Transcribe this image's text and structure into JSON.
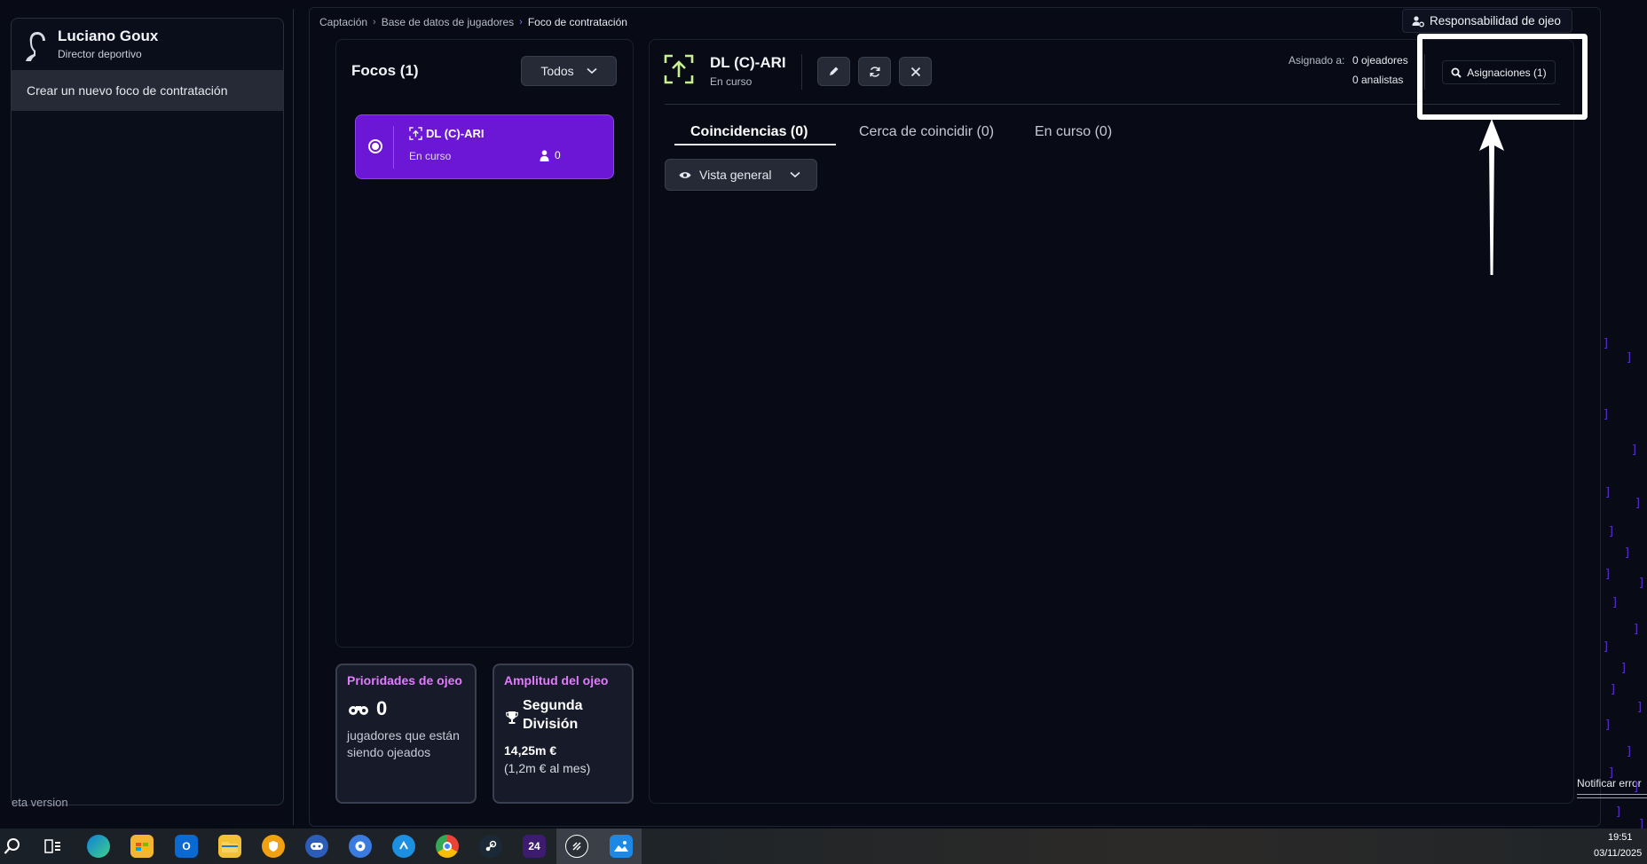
{
  "user": {
    "name": "Luciano Goux",
    "role": "Director deportivo"
  },
  "sidebar": {
    "new_focus_label": "Crear un nuevo foco de contratación",
    "beta_label": "eta version"
  },
  "breadcrumb": {
    "items": [
      "Captación",
      "Base de datos de jugadores",
      "Foco de contratación"
    ]
  },
  "header": {
    "responsibility_label": "Responsabilidad de ojeo"
  },
  "focos": {
    "title": "Focos (1)",
    "filter_value": "Todos",
    "items": [
      {
        "name": "DL (C)-ARI",
        "status": "En curso",
        "count": "0",
        "selected": true
      }
    ]
  },
  "stats": {
    "priorities": {
      "title": "Prioridades de ojeo",
      "value": "0",
      "description": "jugadores que están siendo ojeados"
    },
    "amplitude": {
      "title": "Amplitud del ojeo",
      "league": "Segunda División",
      "value": "14,25m €",
      "per_month": "(1,2m € al mes)"
    }
  },
  "detail": {
    "name": "DL (C)-ARI",
    "status": "En curso",
    "assigned_label": "Asignado a:",
    "scouts": "0 ojeadores",
    "analysts": "0 analistas",
    "assignments_label": "Asignaciones (1)",
    "tabs": [
      "Coincidencias (0)",
      "Cerca de coincidir (0)",
      "En curso (0)"
    ],
    "view_label": "Vista general"
  },
  "footer": {
    "report_error": "Notificar error"
  },
  "taskbar": {
    "time": "19:51",
    "date": "03/11/2025",
    "apps": [
      "search-icon",
      "task-view-icon",
      "edge-icon",
      "store-icon",
      "outlook-icon",
      "explorer-icon",
      "vpn-icon",
      "controller-icon",
      "media-icon",
      "sync-icon",
      "chrome-icon",
      "steam-icon",
      "fm24-icon",
      "browser-icon",
      "photos-icon"
    ],
    "fm24_label": "24"
  },
  "colors": {
    "accent": "#6c16d6",
    "stat_title": "#e27bff",
    "detail_icon": "#c8f08f"
  }
}
